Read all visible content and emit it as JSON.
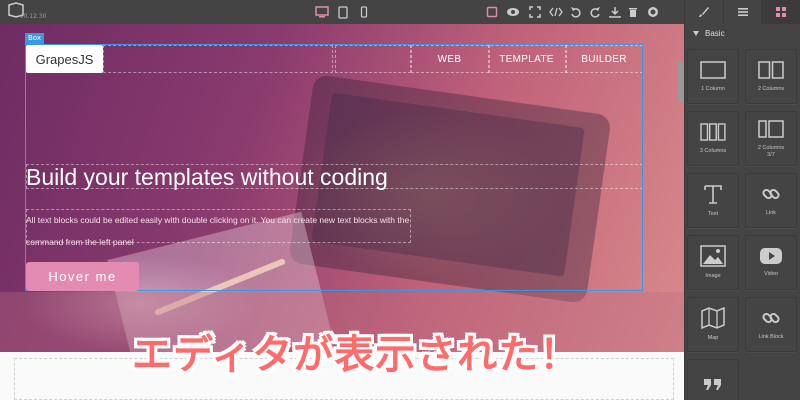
{
  "app": {
    "version": "v0.12.30"
  },
  "toolbar": {
    "devices": [
      "desktop-icon",
      "tablet-icon",
      "mobile-icon"
    ],
    "actions": [
      "sw-visibility-icon",
      "preview-icon",
      "fullscreen-icon",
      "code-icon",
      "undo-icon",
      "redo-icon",
      "import-icon",
      "trash-icon",
      "github-icon"
    ],
    "accent": "#e38bb2"
  },
  "panel_tabs": [
    "style-manager-icon",
    "layer-manager-icon",
    "blocks-icon"
  ],
  "canvas": {
    "selected_badge": "Box",
    "brand": "GrapesJS",
    "nav": [
      "WEB",
      "TEMPLATE",
      "BUILDER"
    ],
    "hero_title": "Build your templates without coding",
    "hero_text": "All text blocks could be edited easily with double clicking on it. You can create new text blocks with the command from the left panel",
    "hero_button": "Hover me"
  },
  "blocks": {
    "category": "Basic",
    "items": [
      {
        "label": "1 Column",
        "icon": "one-column-icon"
      },
      {
        "label": "2 Columns",
        "icon": "two-columns-icon"
      },
      {
        "label": "3 Columns",
        "icon": "three-columns-icon"
      },
      {
        "label": "2 Columns\n3/7",
        "icon": "two-columns-3-7-icon"
      },
      {
        "label": "Text",
        "icon": "text-icon"
      },
      {
        "label": "Link",
        "icon": "link-icon"
      },
      {
        "label": "Image",
        "icon": "image-icon"
      },
      {
        "label": "Video",
        "icon": "video-icon"
      },
      {
        "label": "Map",
        "icon": "map-icon"
      },
      {
        "label": "Link Block",
        "icon": "link-block-icon"
      },
      {
        "label": "",
        "icon": "quote-icon"
      }
    ]
  },
  "caption": "エディタが表示された！"
}
